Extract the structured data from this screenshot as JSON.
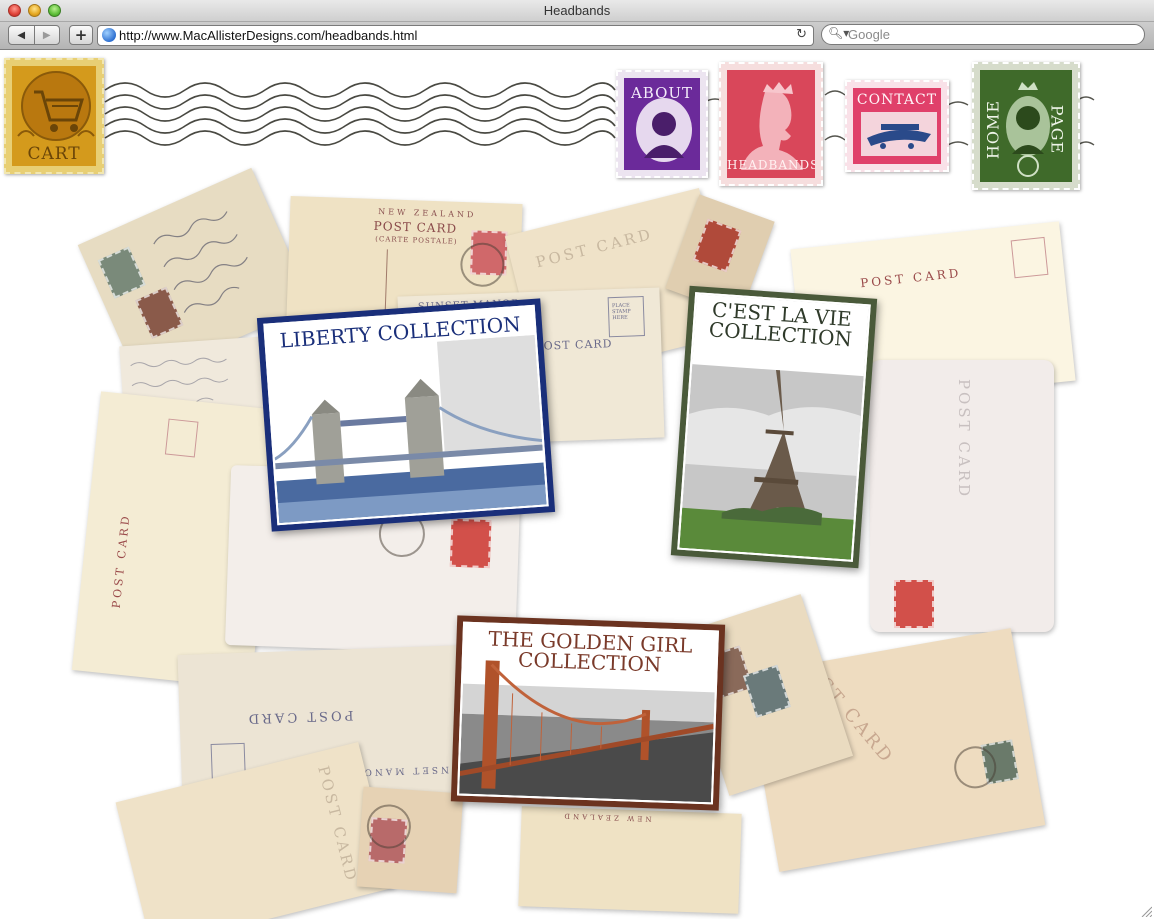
{
  "window": {
    "title": "Headbands"
  },
  "toolbar": {
    "back_icon": "back-arrow-icon",
    "forward_icon": "forward-arrow-icon",
    "add_bookmark_icon": "plus-icon",
    "add_bookmark_label": "+",
    "url": "http://www.MacAllisterDesigns.com/headbands.html",
    "reload_icon": "reload-icon",
    "search_placeholder": "Google"
  },
  "nav": {
    "cart": "CART",
    "about": "ABOUT",
    "headbands": "HEADBANDS",
    "contact": "CONTACT",
    "home_left": "HOME",
    "home_right": "PAGE"
  },
  "collections": {
    "liberty": "LIBERTY COLLECTION",
    "cest_la_vie": "C'EST LA VIE COLLECTION",
    "golden_girl": "THE GOLDEN GIRL COLLECTION"
  },
  "postcards": {
    "label": "POST CARD",
    "label_alt": "POST CARD",
    "new_zealand": "NEW ZEALAND",
    "carte_postale": "(CARTE POSTALE)",
    "sunset_manor": "SUNSET MANOR",
    "place_stamp": "PLACE STAMP HERE"
  },
  "colors": {
    "cart_stamp": "#d49a1c",
    "about_stamp": "#6b2a9a",
    "headbands_stamp": "#d9475a",
    "contact_stamp": "#e0406a",
    "home_stamp": "#3f6a2a",
    "liberty_border": "#1a2f7a",
    "cest_la_vie_border": "#4a5a3a",
    "golden_girl_border": "#6b3320",
    "postcard_paper": "#efe3c8",
    "postcard_ink": "#9a4a4a"
  }
}
